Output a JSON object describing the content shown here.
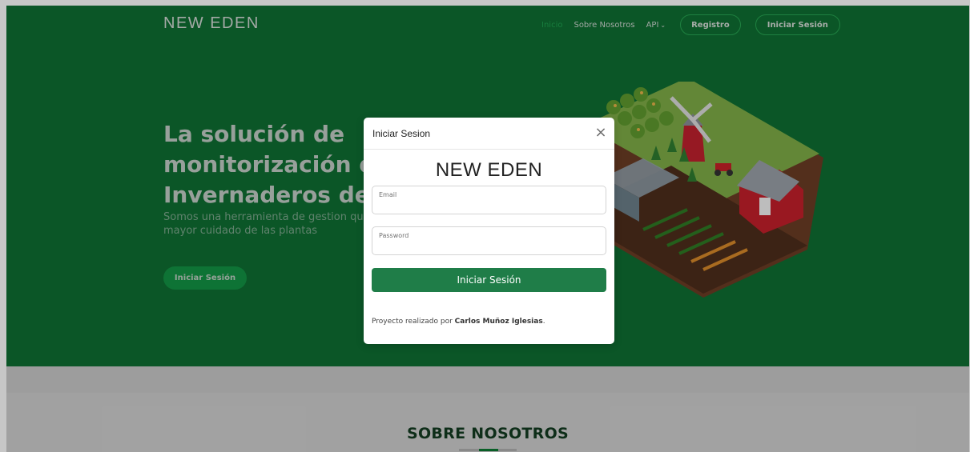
{
  "navbar": {
    "brand": "NEW EDEN",
    "links": [
      "Inicio",
      "Sobre Nosotros",
      "API"
    ],
    "register": "Registro",
    "login": "Iniciar Sesión"
  },
  "hero": {
    "title_lines": [
      "La solución de",
      "monitorización de",
      "Invernaderos defi"
    ],
    "subtitle_lines": [
      "Somos una herramienta de gestion qu",
      "mayor cuidado de las plantas"
    ],
    "cta": "Iniciar Sesión"
  },
  "about": {
    "title": "SOBRE NOSOTROS"
  },
  "modal": {
    "title": "Iniciar Sesion",
    "close": "×",
    "brand": "NEW EDEN",
    "email_label": "Email",
    "password_label": "Password",
    "submit": "Iniciar Sesión",
    "credit_prefix": "Proyecto realizado por ",
    "credit_name": "Carlos Muñoz Iglesias",
    "credit_suffix": "."
  },
  "colors": {
    "hero_bg": "#0f6f32",
    "accent": "#1f7d48",
    "about_title": "#123b20"
  }
}
